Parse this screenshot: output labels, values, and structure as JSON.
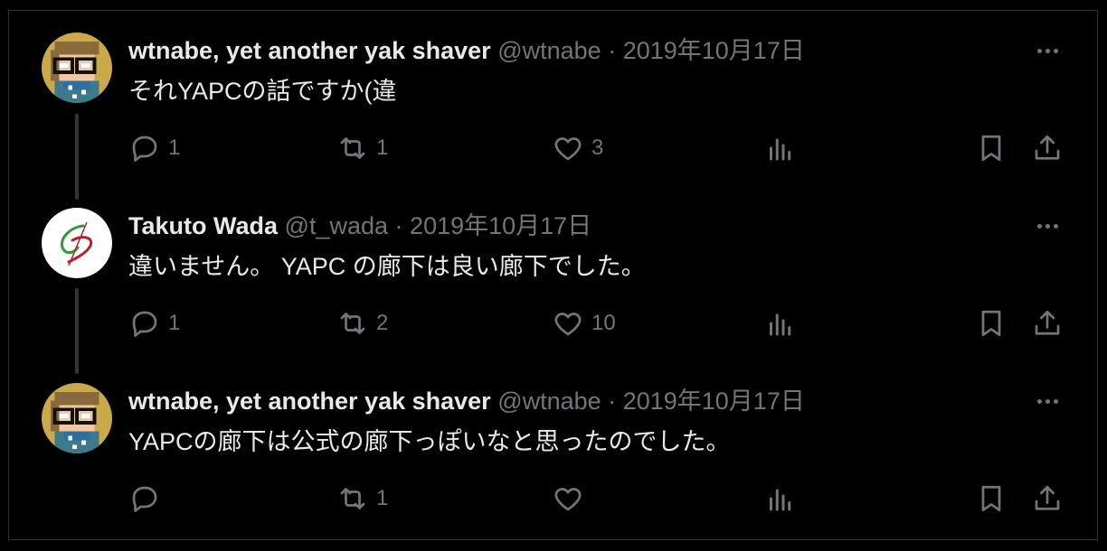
{
  "tweets": [
    {
      "name": "wtnabe, yet another yak shaver",
      "handle": "@wtnabe",
      "separator": "·",
      "date": "2019年10月17日",
      "text": "それYAPCの話ですか(違",
      "reply_count": "1",
      "retweet_count": "1",
      "like_count": "3",
      "avatar": "pixel-art-glasses-avatar"
    },
    {
      "name": "Takuto Wada",
      "handle": "@t_wada",
      "separator": "·",
      "date": "2019年10月17日",
      "text": "違いません。 YAPC の廊下は良い廊下でした。",
      "reply_count": "1",
      "retweet_count": "2",
      "like_count": "10",
      "avatar": "swirl-logo-avatar"
    },
    {
      "name": "wtnabe, yet another yak shaver",
      "handle": "@wtnabe",
      "separator": "·",
      "date": "2019年10月17日",
      "text": "YAPCの廊下は公式の廊下っぽいなと思ったのでした。",
      "reply_count": "",
      "retweet_count": "1",
      "like_count": "",
      "avatar": "pixel-art-glasses-avatar"
    }
  ],
  "colors": {
    "background": "#000000",
    "text": "#e7e9ea",
    "muted": "#71767b",
    "border": "#2f3336"
  }
}
